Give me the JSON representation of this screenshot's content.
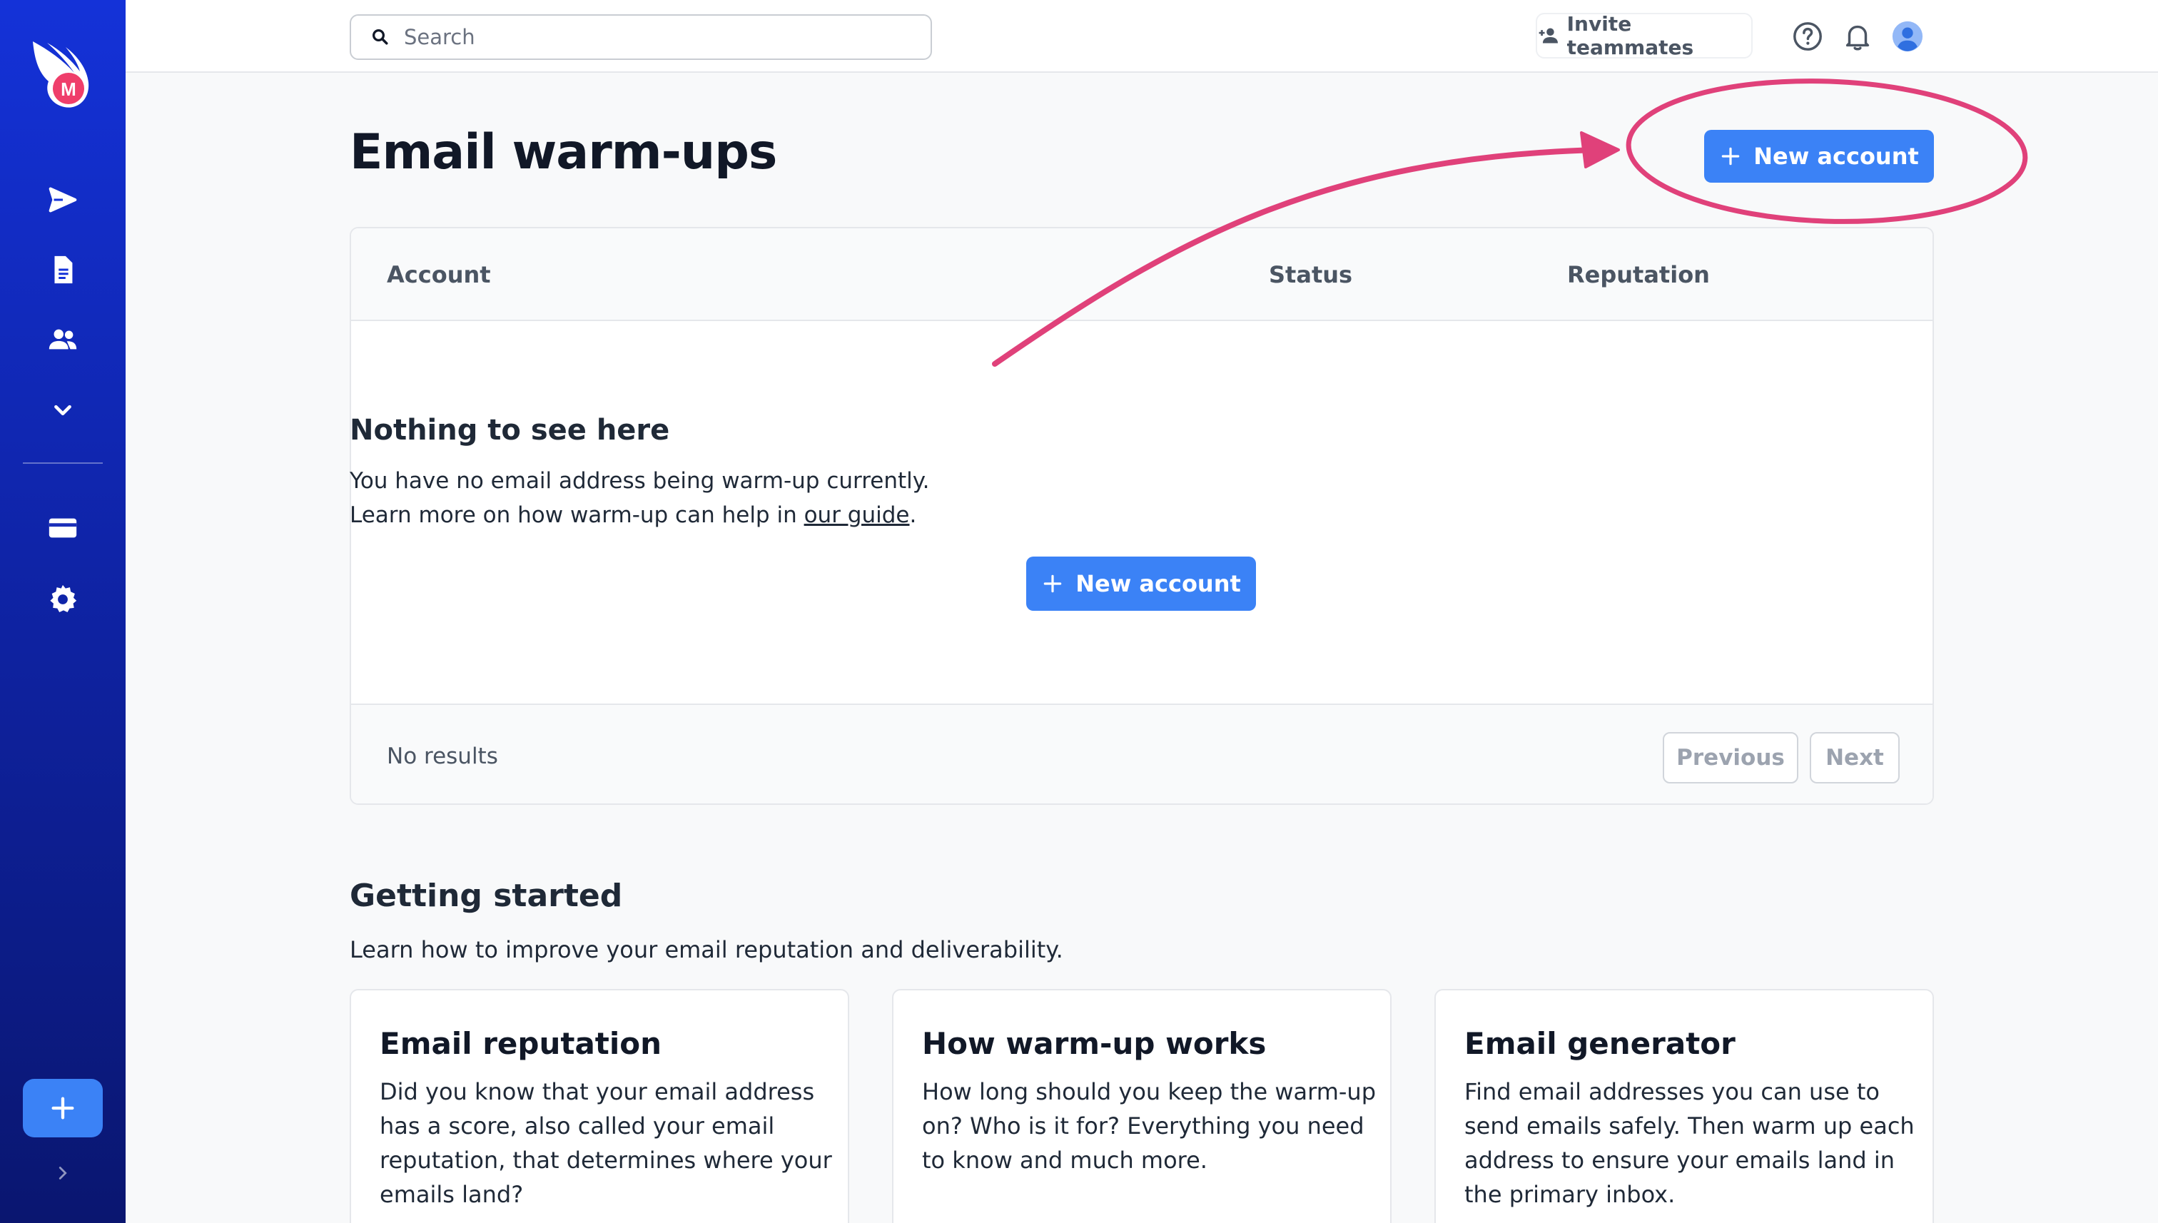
{
  "search": {
    "placeholder": "Search"
  },
  "topbar": {
    "invite_label": "Invite teammates"
  },
  "page": {
    "title": "Email warm-ups",
    "new_account_label": "New account"
  },
  "table": {
    "columns": [
      "Account",
      "Status",
      "Reputation"
    ],
    "empty": {
      "title": "Nothing to see here",
      "line1": "You have no email address being warm-up currently.",
      "line2_prefix": "Learn more on how warm-up can help in ",
      "line2_link": "our guide",
      "line2_suffix": ".",
      "button_label": "New account"
    },
    "footer": {
      "status": "No results",
      "previous": "Previous",
      "next": "Next"
    }
  },
  "getting_started": {
    "title": "Getting started",
    "subtitle": "Learn how to improve your email reputation and deliverability.",
    "cards": [
      {
        "title": "Email reputation",
        "body": "Did you know that your email address has a score, also called your email reputation, that determines where your emails land?"
      },
      {
        "title": "How warm-up works",
        "body": "How long should you keep the warm-up on? Who is it for? Everything you need to know and much more."
      },
      {
        "title": "Email generator",
        "body": "Find email addresses you can use to send emails safely. Then warm up each address to ensure your emails land in the primary inbox."
      }
    ]
  },
  "sidebar": {
    "icons": [
      "logo-icon",
      "send-icon",
      "document-icon",
      "contacts-icon",
      "chevron-down-icon",
      "credit-card-icon",
      "gear-icon",
      "plus-icon",
      "chevron-right-icon"
    ]
  },
  "colors": {
    "sidebar_top": "#1432d8",
    "sidebar_bottom": "#0a1670",
    "primary": "#3b82f6",
    "annotation": "#e0417a"
  }
}
